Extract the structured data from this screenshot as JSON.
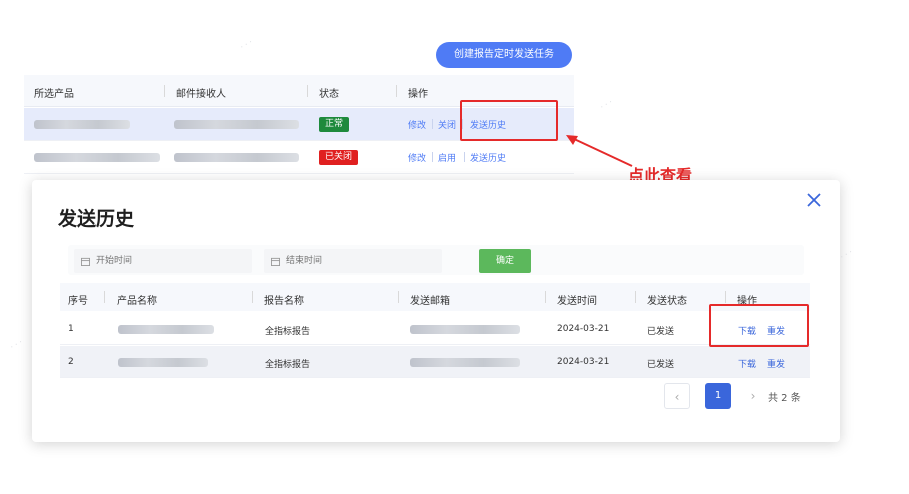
{
  "toolbar": {
    "create_label": "创建报告定时发送任务"
  },
  "task_table": {
    "headers": [
      "所选产品",
      "邮件接收人",
      "状态",
      "操作"
    ],
    "rows": [
      {
        "status": "正常",
        "status_color": "#1e8a3c",
        "actions": [
          "修改",
          "关闭",
          "发送历史"
        ]
      },
      {
        "status": "已关闭",
        "status_color": "#e02020",
        "actions": [
          "修改",
          "启用",
          "发送历史"
        ]
      }
    ]
  },
  "callout": {
    "text": "点此查看",
    "color": "#e52a2a"
  },
  "modal": {
    "title": "发送历史",
    "filter": {
      "start_placeholder": "开始时间",
      "end_placeholder": "结束时间",
      "confirm_label": "确定"
    },
    "table": {
      "headers": [
        "序号",
        "产品名称",
        "报告名称",
        "发送邮箱",
        "发送时间",
        "发送状态",
        "操作"
      ],
      "rows": [
        {
          "index": "1",
          "report": "全指标报告",
          "time": "2024-03-21",
          "state": "已发送",
          "download": "下载",
          "resend": "重发"
        },
        {
          "index": "2",
          "report": "全指标报告",
          "time": "2024-03-21",
          "state": "已发送",
          "download": "下载",
          "resend": "重发"
        }
      ]
    },
    "pagination": {
      "current": "1",
      "prev": "‹",
      "next": "›",
      "total": "共 2 条"
    }
  },
  "colors": {
    "accent": "#4f7bf5",
    "confirm": "#5cb85c",
    "highlight": "#e52a2a"
  }
}
